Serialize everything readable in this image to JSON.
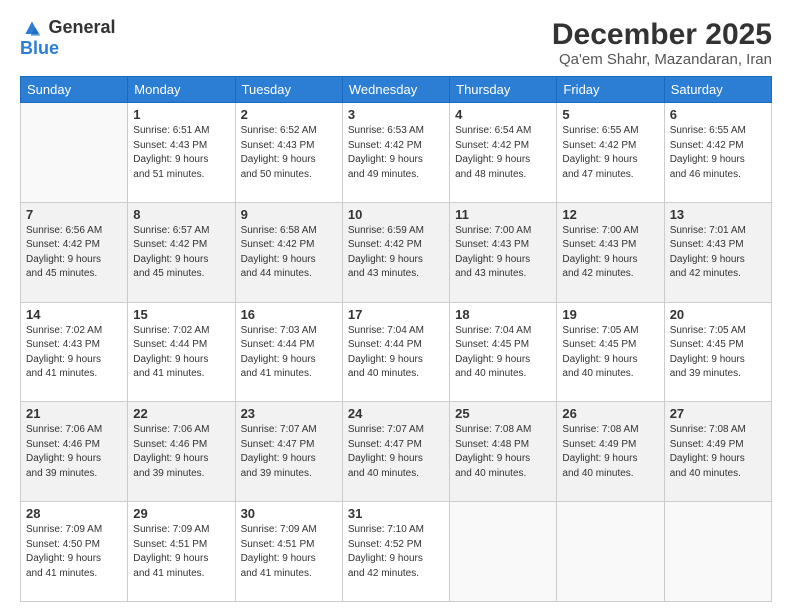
{
  "logo": {
    "general": "General",
    "blue": "Blue"
  },
  "title": "December 2025",
  "subtitle": "Qa'em Shahr, Mazandaran, Iran",
  "headers": [
    "Sunday",
    "Monday",
    "Tuesday",
    "Wednesday",
    "Thursday",
    "Friday",
    "Saturday"
  ],
  "weeks": [
    [
      {
        "day": "",
        "info": ""
      },
      {
        "day": "1",
        "info": "Sunrise: 6:51 AM\nSunset: 4:43 PM\nDaylight: 9 hours\nand 51 minutes."
      },
      {
        "day": "2",
        "info": "Sunrise: 6:52 AM\nSunset: 4:43 PM\nDaylight: 9 hours\nand 50 minutes."
      },
      {
        "day": "3",
        "info": "Sunrise: 6:53 AM\nSunset: 4:42 PM\nDaylight: 9 hours\nand 49 minutes."
      },
      {
        "day": "4",
        "info": "Sunrise: 6:54 AM\nSunset: 4:42 PM\nDaylight: 9 hours\nand 48 minutes."
      },
      {
        "day": "5",
        "info": "Sunrise: 6:55 AM\nSunset: 4:42 PM\nDaylight: 9 hours\nand 47 minutes."
      },
      {
        "day": "6",
        "info": "Sunrise: 6:55 AM\nSunset: 4:42 PM\nDaylight: 9 hours\nand 46 minutes."
      }
    ],
    [
      {
        "day": "7",
        "info": "Sunrise: 6:56 AM\nSunset: 4:42 PM\nDaylight: 9 hours\nand 45 minutes."
      },
      {
        "day": "8",
        "info": "Sunrise: 6:57 AM\nSunset: 4:42 PM\nDaylight: 9 hours\nand 45 minutes."
      },
      {
        "day": "9",
        "info": "Sunrise: 6:58 AM\nSunset: 4:42 PM\nDaylight: 9 hours\nand 44 minutes."
      },
      {
        "day": "10",
        "info": "Sunrise: 6:59 AM\nSunset: 4:42 PM\nDaylight: 9 hours\nand 43 minutes."
      },
      {
        "day": "11",
        "info": "Sunrise: 7:00 AM\nSunset: 4:43 PM\nDaylight: 9 hours\nand 43 minutes."
      },
      {
        "day": "12",
        "info": "Sunrise: 7:00 AM\nSunset: 4:43 PM\nDaylight: 9 hours\nand 42 minutes."
      },
      {
        "day": "13",
        "info": "Sunrise: 7:01 AM\nSunset: 4:43 PM\nDaylight: 9 hours\nand 42 minutes."
      }
    ],
    [
      {
        "day": "14",
        "info": "Sunrise: 7:02 AM\nSunset: 4:43 PM\nDaylight: 9 hours\nand 41 minutes."
      },
      {
        "day": "15",
        "info": "Sunrise: 7:02 AM\nSunset: 4:44 PM\nDaylight: 9 hours\nand 41 minutes."
      },
      {
        "day": "16",
        "info": "Sunrise: 7:03 AM\nSunset: 4:44 PM\nDaylight: 9 hours\nand 41 minutes."
      },
      {
        "day": "17",
        "info": "Sunrise: 7:04 AM\nSunset: 4:44 PM\nDaylight: 9 hours\nand 40 minutes."
      },
      {
        "day": "18",
        "info": "Sunrise: 7:04 AM\nSunset: 4:45 PM\nDaylight: 9 hours\nand 40 minutes."
      },
      {
        "day": "19",
        "info": "Sunrise: 7:05 AM\nSunset: 4:45 PM\nDaylight: 9 hours\nand 40 minutes."
      },
      {
        "day": "20",
        "info": "Sunrise: 7:05 AM\nSunset: 4:45 PM\nDaylight: 9 hours\nand 39 minutes."
      }
    ],
    [
      {
        "day": "21",
        "info": "Sunrise: 7:06 AM\nSunset: 4:46 PM\nDaylight: 9 hours\nand 39 minutes."
      },
      {
        "day": "22",
        "info": "Sunrise: 7:06 AM\nSunset: 4:46 PM\nDaylight: 9 hours\nand 39 minutes."
      },
      {
        "day": "23",
        "info": "Sunrise: 7:07 AM\nSunset: 4:47 PM\nDaylight: 9 hours\nand 39 minutes."
      },
      {
        "day": "24",
        "info": "Sunrise: 7:07 AM\nSunset: 4:47 PM\nDaylight: 9 hours\nand 40 minutes."
      },
      {
        "day": "25",
        "info": "Sunrise: 7:08 AM\nSunset: 4:48 PM\nDaylight: 9 hours\nand 40 minutes."
      },
      {
        "day": "26",
        "info": "Sunrise: 7:08 AM\nSunset: 4:49 PM\nDaylight: 9 hours\nand 40 minutes."
      },
      {
        "day": "27",
        "info": "Sunrise: 7:08 AM\nSunset: 4:49 PM\nDaylight: 9 hours\nand 40 minutes."
      }
    ],
    [
      {
        "day": "28",
        "info": "Sunrise: 7:09 AM\nSunset: 4:50 PM\nDaylight: 9 hours\nand 41 minutes."
      },
      {
        "day": "29",
        "info": "Sunrise: 7:09 AM\nSunset: 4:51 PM\nDaylight: 9 hours\nand 41 minutes."
      },
      {
        "day": "30",
        "info": "Sunrise: 7:09 AM\nSunset: 4:51 PM\nDaylight: 9 hours\nand 41 minutes."
      },
      {
        "day": "31",
        "info": "Sunrise: 7:10 AM\nSunset: 4:52 PM\nDaylight: 9 hours\nand 42 minutes."
      },
      {
        "day": "",
        "info": ""
      },
      {
        "day": "",
        "info": ""
      },
      {
        "day": "",
        "info": ""
      }
    ]
  ]
}
